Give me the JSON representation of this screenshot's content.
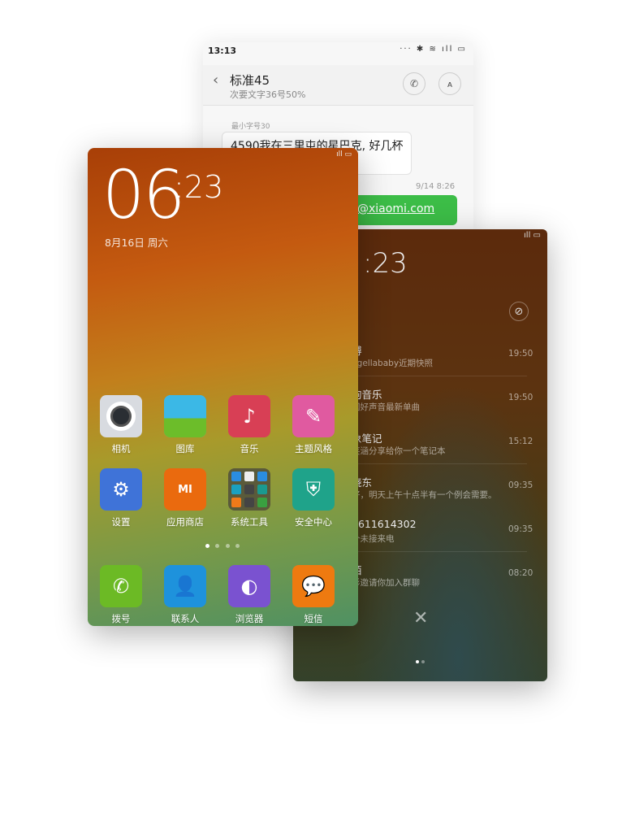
{
  "message_screen": {
    "status_time": "13:13",
    "status_icons": "··· ✱ ≋ ıll ▭",
    "back_icon": "‹",
    "contact_title": "标准45",
    "contact_subtitle": "次要文字36号50%",
    "call_icon": "✆",
    "contact_icon": "👤",
    "small_label": "最小字号30",
    "incoming_text": "4590我在三里屯的星巴克, 好几杯\n来?",
    "timestamp": "9/14 8:26",
    "outgoing_text": "@xiaomi.com",
    "accent_color": "#3cbd47"
  },
  "notification_screen": {
    "status_icons": "ıll ▭",
    "time": ":23",
    "clear_icon": "⊘",
    "notifications": [
      {
        "title": "博",
        "text": "ngellababy近期快照",
        "time": "19:50"
      },
      {
        "title": "狗音乐",
        "text": "国好声音最新单曲",
        "time": "19:50"
      },
      {
        "title": "象笔记",
        "text": "笑涵分享给你一个笔记本",
        "time": "15:12"
      },
      {
        "title": "晓东",
        "text": "好，明天上午十点半有一个例会需要。",
        "time": "09:35"
      },
      {
        "title": "3611614302",
        "text": "个未接来电",
        "time": "09:35"
      },
      {
        "title": "陌",
        "text": "杉邀请你加入群聊",
        "time": "08:20"
      }
    ],
    "dismiss_icon": "✕",
    "page_count": 2,
    "current_page": 1
  },
  "home_screen": {
    "status_icons": "ıll ▭",
    "hour": "06",
    "minute": ":23",
    "date": "8月16日 周六",
    "apps": [
      {
        "label": "相机",
        "icon": "camera-icon",
        "color": "#d8dbe0"
      },
      {
        "label": "图库",
        "icon": "gallery-icon",
        "color": "#4cc0e0"
      },
      {
        "label": "音乐",
        "icon": "music-icon",
        "color": "#d83f55"
      },
      {
        "label": "主题风格",
        "icon": "theme-brush-icon",
        "color": "#e05aa0"
      },
      {
        "label": "设置",
        "icon": "gear-icon",
        "color": "#3f73d8"
      },
      {
        "label": "应用商店",
        "icon": "mi-store-icon",
        "color": "#ea6a0e"
      },
      {
        "label": "系统工具",
        "icon": "folder-icon",
        "color": "#5a5a3a"
      },
      {
        "label": "安全中心",
        "icon": "shield-icon",
        "color": "#1fa38a"
      }
    ],
    "dock": [
      {
        "label": "拨号",
        "icon": "phone-icon",
        "color": "#6cba25"
      },
      {
        "label": "联系人",
        "icon": "contacts-icon",
        "color": "#1e92dc"
      },
      {
        "label": "浏览器",
        "icon": "browser-icon",
        "color": "#7a52d0"
      },
      {
        "label": "短信",
        "icon": "message-icon",
        "color": "#ee7a10"
      }
    ],
    "page_count": 4,
    "current_page": 1,
    "mi_logo": "mi"
  }
}
